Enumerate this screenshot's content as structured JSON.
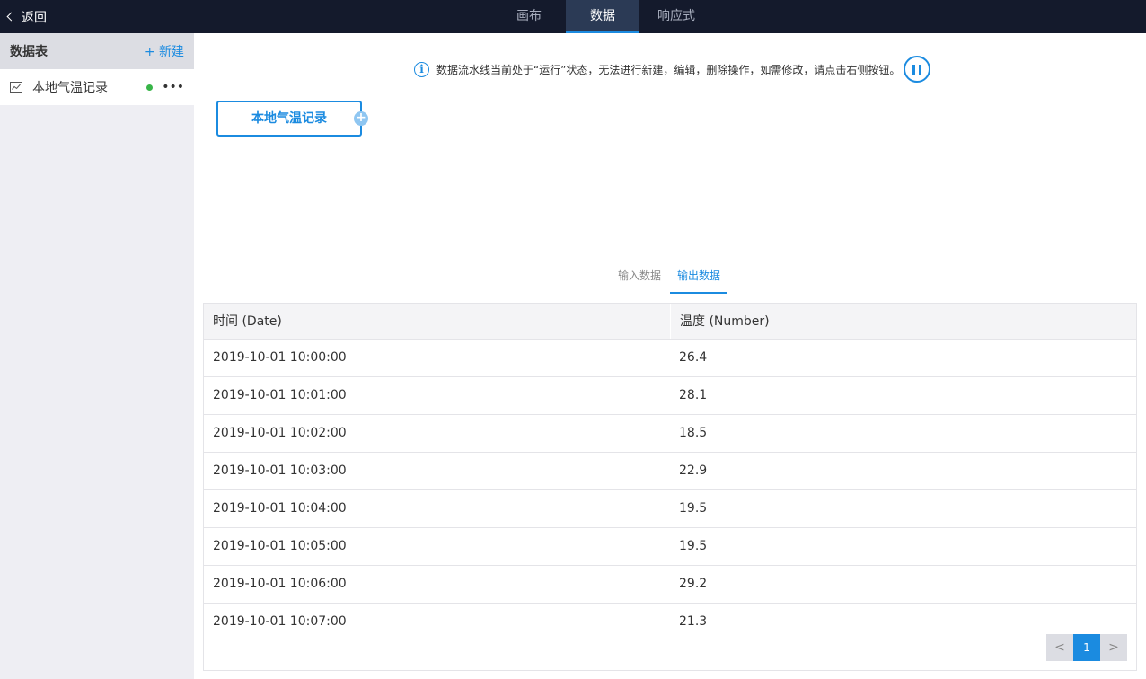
{
  "topbar": {
    "back_label": "返回",
    "tabs": [
      {
        "label": "画布",
        "active": false
      },
      {
        "label": "数据",
        "active": true
      },
      {
        "label": "响应式",
        "active": false
      }
    ]
  },
  "sidebar": {
    "title": "数据表",
    "new_label": "+ 新建",
    "items": [
      {
        "label": "本地气温记录",
        "icon": "line-chart-icon",
        "status": "running",
        "status_color": "#38b548"
      }
    ]
  },
  "notice": {
    "text": "数据流水线当前处于“运行”状态，无法进行新建，编辑，删除操作，如需修改，请点击右侧按钮。"
  },
  "node": {
    "label": "本地气温记录",
    "add_symbol": "+"
  },
  "data_tabs": [
    {
      "label": "输入数据",
      "active": false
    },
    {
      "label": "输出数据",
      "active": true
    }
  ],
  "table": {
    "columns": [
      "时间 (Date)",
      "温度 (Number)"
    ],
    "rows": [
      [
        "2019-10-01 10:00:00",
        "26.4"
      ],
      [
        "2019-10-01 10:01:00",
        "28.1"
      ],
      [
        "2019-10-01 10:02:00",
        "18.5"
      ],
      [
        "2019-10-01 10:03:00",
        "22.9"
      ],
      [
        "2019-10-01 10:04:00",
        "19.5"
      ],
      [
        "2019-10-01 10:05:00",
        "19.5"
      ],
      [
        "2019-10-01 10:06:00",
        "29.2"
      ],
      [
        "2019-10-01 10:07:00",
        "21.3"
      ]
    ]
  },
  "pagination": {
    "prev": "<",
    "current": "1",
    "next": ">"
  },
  "colors": {
    "accent": "#1b8be0",
    "topbar": "#141a2c",
    "status_running": "#38b548"
  }
}
